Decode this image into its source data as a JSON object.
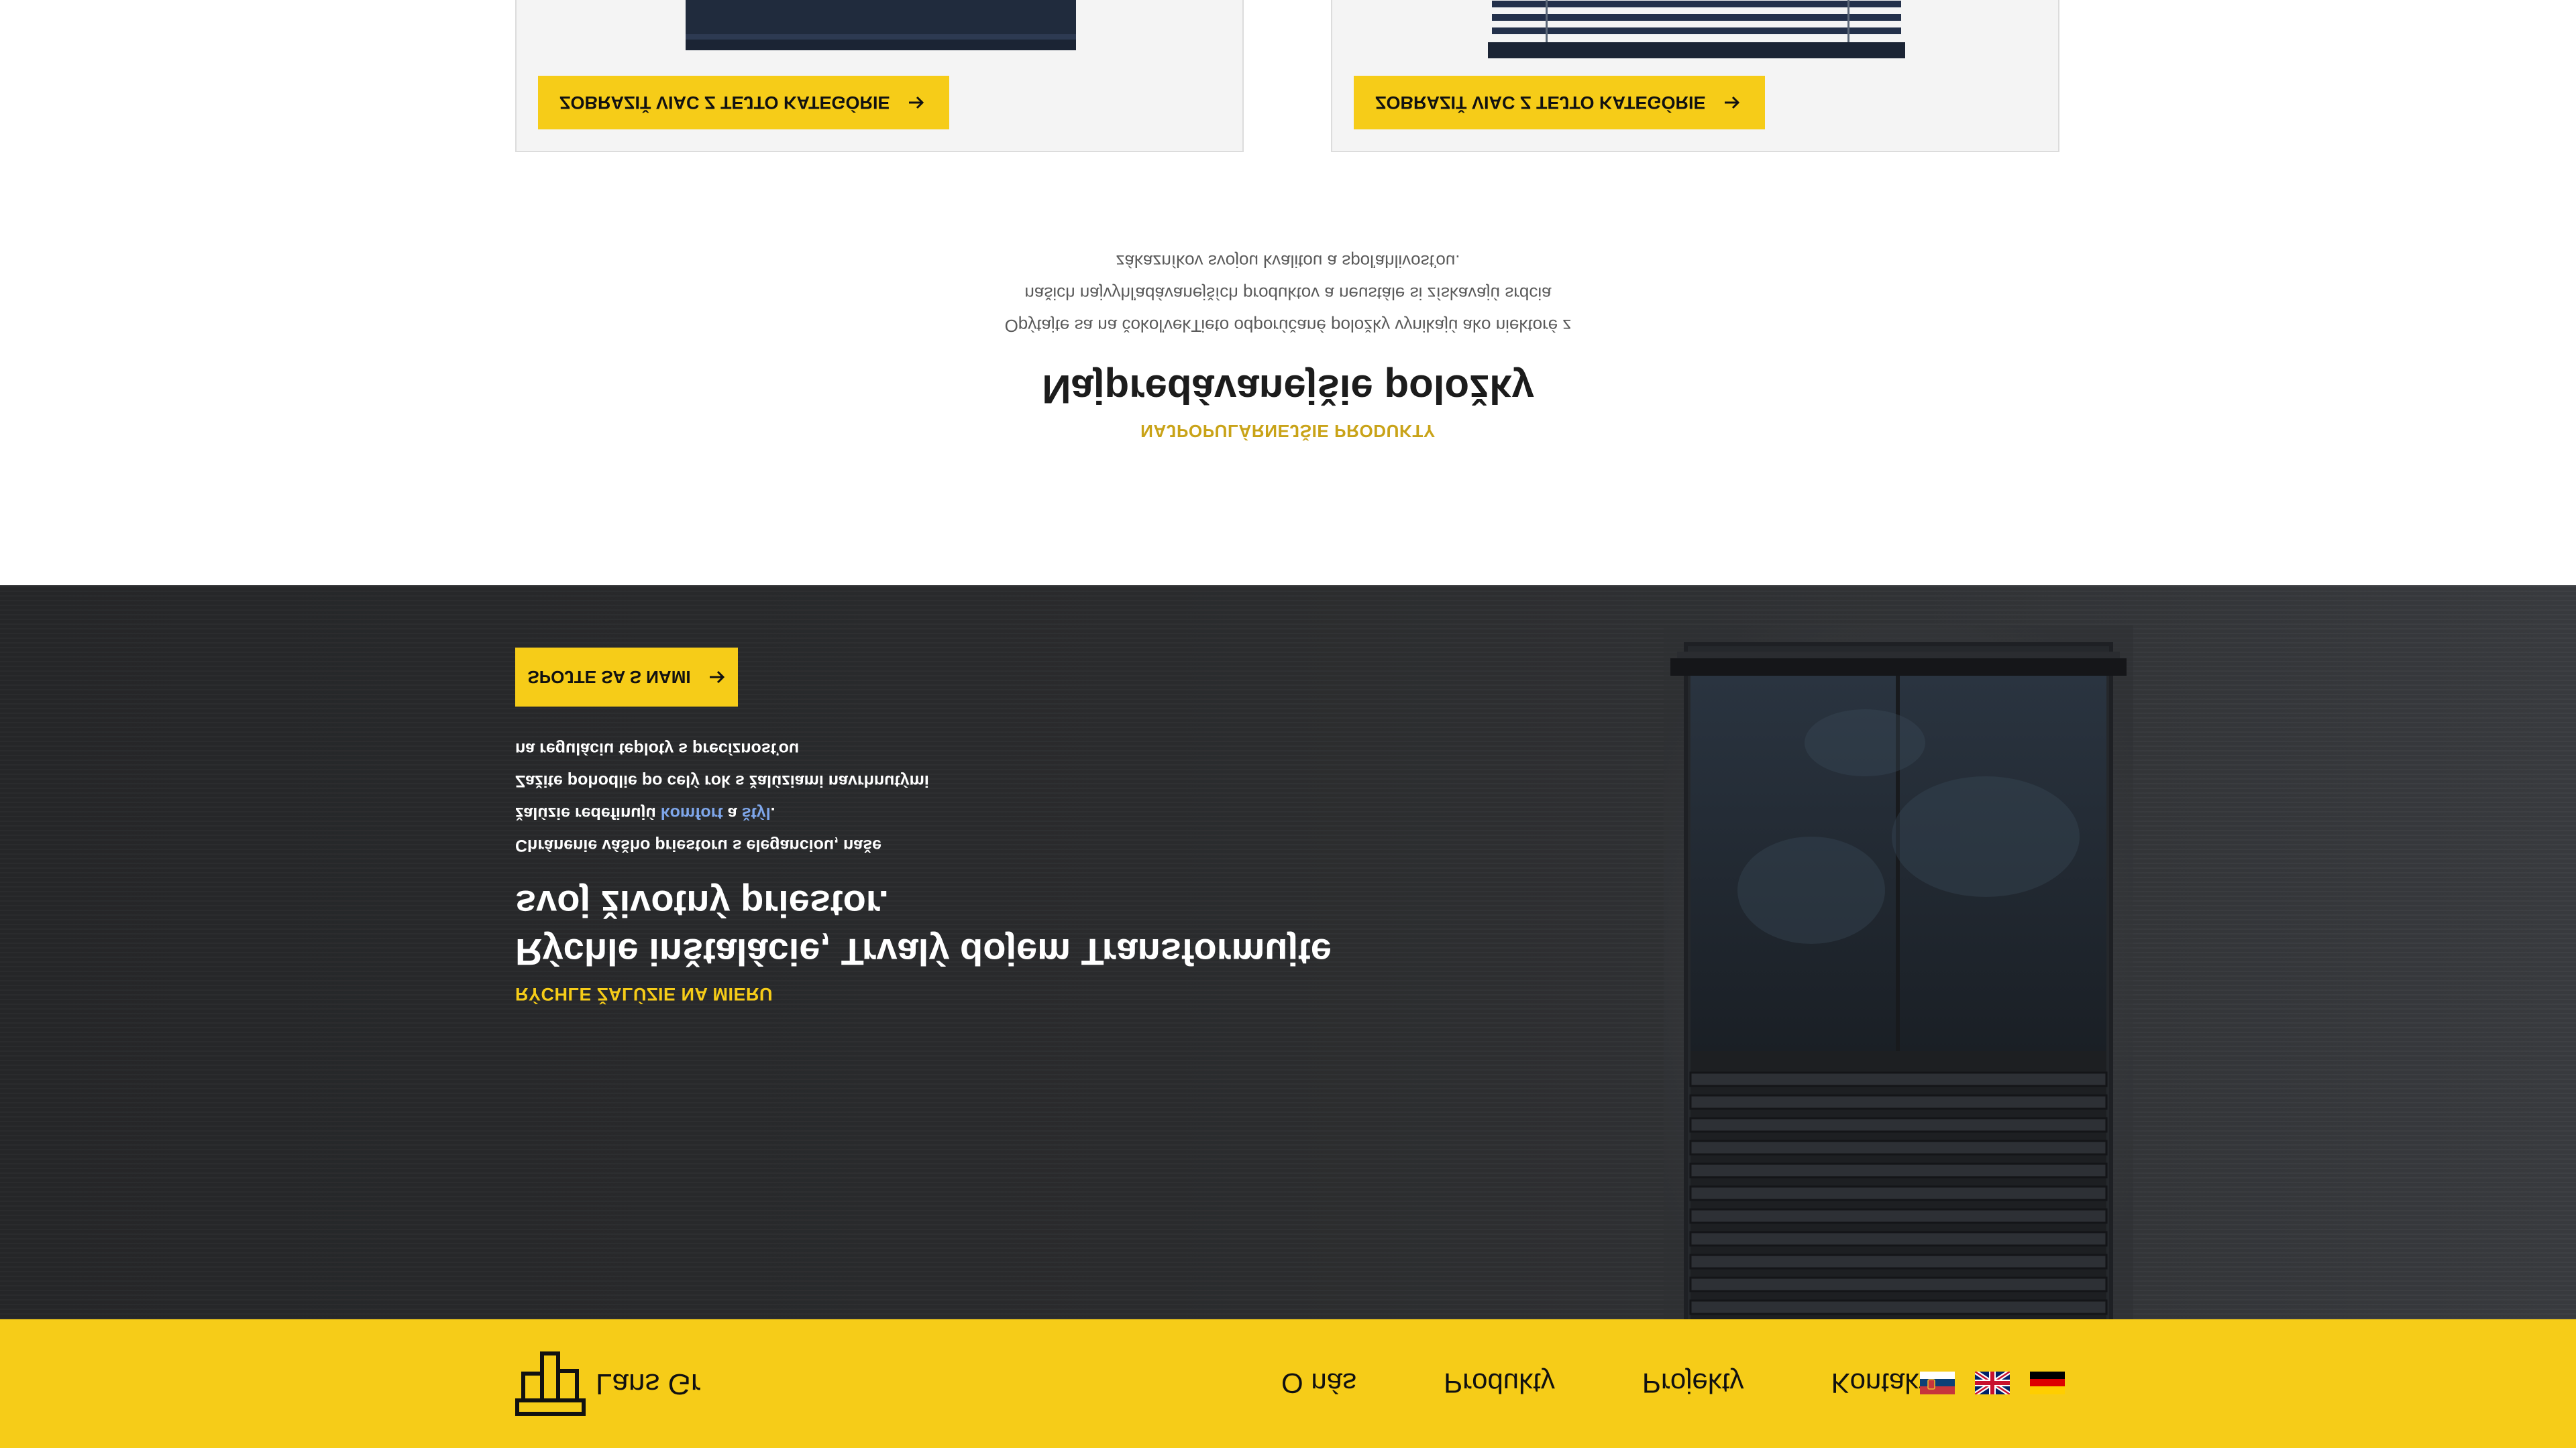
{
  "header": {
    "logo_text": "Lans Gr",
    "nav": [
      "O nás",
      "Produkty",
      "Projekty",
      "Kontakt"
    ],
    "flags": [
      "serbian-flag-icon",
      "uk-flag-icon",
      "german-flag-icon"
    ]
  },
  "hero": {
    "eyebrow": "RÝCHLE ŽALÚZIE NA MIERU",
    "title_line1": "Rýchle inštalácie, Trvalý dojem Transformujte",
    "title_line2": "svoj životný priestor.",
    "desc_line1": "Chránenie vášho priestoru s eleganciou, naše",
    "desc_line2_pre": "žalúzie redefinujú ",
    "desc_line2_hl1": "komfort",
    "desc_line2_mid": " a ",
    "desc_line2_hl2": "štýl",
    "desc_line2_post": ".",
    "desc_line3": "Zažite pohodlie po celý rok s žalúziami navrhnutými",
    "desc_line4": "na reguláciu teploty s precíznosťou",
    "cta_label": "SPOJTE SA S NAMI"
  },
  "popular": {
    "eyebrow": "NAJPOPULÁRNEJŠIE PRODUKTY",
    "title": "Najpredávanejšie položky",
    "desc_line1": "Opýtajte sa na čokoľvekTieto odporúčané položky vynikajú ako niektoré z",
    "desc_line2": "našich najvyhľadávanejších produktov a neustále si získavajú srdcia",
    "desc_line3": "zákazníkov svojou kvalitou a spoľahlivosťou."
  },
  "cards": [
    {
      "button_label": "ZOBRAZIŤ VIAC Z TEJTO KATEGÓRIE"
    },
    {
      "button_label": "ZOBRAZIŤ VIAC Z TEJTO KATEGÓRIE"
    }
  ],
  "colors": {
    "accent": "#f6cc18",
    "dark_bg": "#2b2c2e",
    "link": "#7ea6ea"
  }
}
